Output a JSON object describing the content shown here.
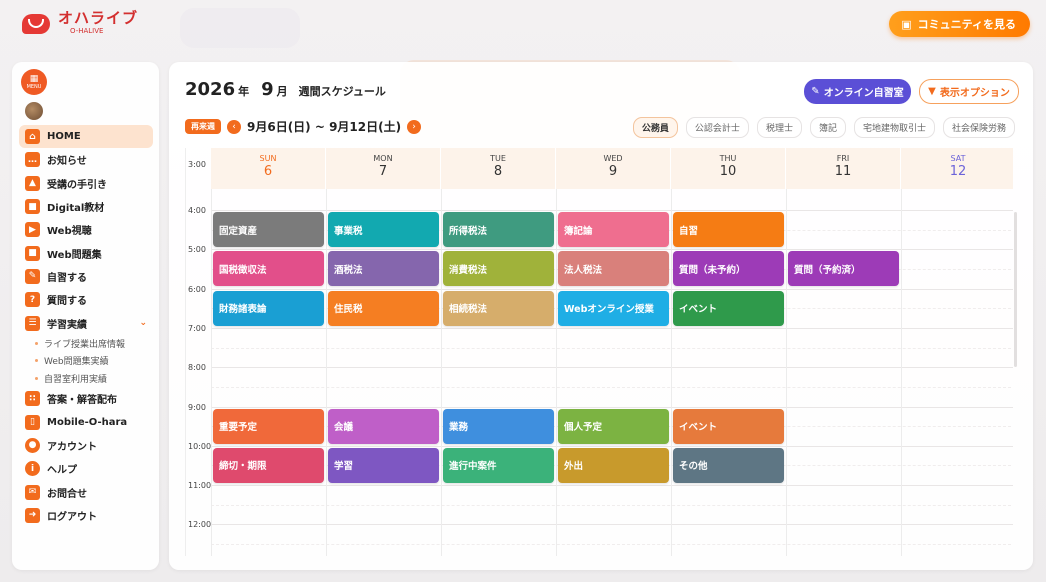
{
  "header": {
    "logo_title": "オハライブ",
    "logo_sub": "O-HALIVE",
    "community_label": "コミュニティを見る"
  },
  "sidebar": {
    "menu_label": "MENU",
    "items": [
      {
        "label": "HOME",
        "icon": "home-icon"
      },
      {
        "label": "お知らせ",
        "icon": "chat-icon"
      },
      {
        "label": "受講の手引き",
        "icon": "graduation-cap-icon"
      },
      {
        "label": "Digital教材",
        "icon": "book-icon"
      },
      {
        "label": "Web視聴",
        "icon": "play-icon"
      },
      {
        "label": "Web問題集",
        "icon": "book-icon"
      },
      {
        "label": "自習する",
        "icon": "pencil-icon"
      },
      {
        "label": "質問する",
        "icon": "question-icon"
      },
      {
        "label": "学習実績",
        "icon": "chart-icon"
      },
      {
        "label": "答案・解答配布",
        "icon": "dots-grid-icon"
      },
      {
        "label": "Mobile-O-hara",
        "icon": "mobile-icon"
      },
      {
        "label": "アカウント",
        "icon": "user-icon"
      },
      {
        "label": "ヘルプ",
        "icon": "info-icon"
      },
      {
        "label": "お問合せ",
        "icon": "mail-icon"
      },
      {
        "label": "ログアウト",
        "icon": "logout-icon"
      }
    ],
    "sub_items": [
      "ライブ授業出席情報",
      "Web問題集実績",
      "自習室利用実績"
    ]
  },
  "main": {
    "year": "2026",
    "year_unit": "年",
    "month": "9",
    "month_unit": "月",
    "schedule_label": "週間スケジュール",
    "online_btn": "オンライン自習室",
    "options_btn": "表示オプション",
    "next_week": "再来週",
    "range": "9月6日(日) ~ 9月12日(土)",
    "filters": [
      "公務員",
      "公認会計士",
      "税理士",
      "簿記",
      "宅地建物取引士",
      "社会保険労務"
    ],
    "days": [
      {
        "name": "SUN",
        "date": "6"
      },
      {
        "name": "MON",
        "date": "7"
      },
      {
        "name": "TUE",
        "date": "8"
      },
      {
        "name": "WED",
        "date": "9"
      },
      {
        "name": "THU",
        "date": "10"
      },
      {
        "name": "FRI",
        "date": "11"
      },
      {
        "name": "SAT",
        "date": "12"
      }
    ],
    "hours": [
      "3:00",
      "4:00",
      "5:00",
      "6:00",
      "7:00",
      "8:00",
      "9:00",
      "10:00",
      "11:00",
      "12:00"
    ],
    "events": [
      {
        "label": "固定資産",
        "day": 0,
        "hour": 4,
        "color": "#7b7b7b"
      },
      {
        "label": "事業税",
        "day": 1,
        "hour": 4,
        "color": "#12a9b0"
      },
      {
        "label": "所得税法",
        "day": 2,
        "hour": 4,
        "color": "#3f9b80"
      },
      {
        "label": "簿記論",
        "day": 3,
        "hour": 4,
        "color": "#ef6e8f"
      },
      {
        "label": "自習",
        "day": 4,
        "hour": 4,
        "color": "#f57c14"
      },
      {
        "label": "国税徴収法",
        "day": 0,
        "hour": 5,
        "color": "#e24f8a"
      },
      {
        "label": "酒税法",
        "day": 1,
        "hour": 5,
        "color": "#8566ad"
      },
      {
        "label": "消費税法",
        "day": 2,
        "hour": 5,
        "color": "#a0b23a"
      },
      {
        "label": "法人税法",
        "day": 3,
        "hour": 5,
        "color": "#d9807b"
      },
      {
        "label": "質問（未予約）",
        "day": 4,
        "hour": 5,
        "color": "#9d3bb7"
      },
      {
        "label": "質問（予約済）",
        "day": 5,
        "hour": 5,
        "color": "#9d3bb7"
      },
      {
        "label": "財務諸表論",
        "day": 0,
        "hour": 6,
        "color": "#1a9fd3"
      },
      {
        "label": "住民税",
        "day": 1,
        "hour": 6,
        "color": "#f57e22"
      },
      {
        "label": "相続税法",
        "day": 2,
        "hour": 6,
        "color": "#d6ad6b"
      },
      {
        "label": "Webオンライン授業",
        "day": 3,
        "hour": 6,
        "color": "#1faee5"
      },
      {
        "label": "イベント",
        "day": 4,
        "hour": 6,
        "color": "#2f9a4b"
      },
      {
        "label": "重要予定",
        "day": 0,
        "hour": 9,
        "color": "#f0693a"
      },
      {
        "label": "会議",
        "day": 1,
        "hour": 9,
        "color": "#bf5fc8"
      },
      {
        "label": "業務",
        "day": 2,
        "hour": 9,
        "color": "#3f8fde"
      },
      {
        "label": "個人予定",
        "day": 3,
        "hour": 9,
        "color": "#7cb342"
      },
      {
        "label": "イベント",
        "day": 4,
        "hour": 9,
        "color": "#e67a3c"
      },
      {
        "label": "締切・期限",
        "day": 0,
        "hour": 10,
        "color": "#df4a6d"
      },
      {
        "label": "学習",
        "day": 1,
        "hour": 10,
        "color": "#7e57c2"
      },
      {
        "label": "進行中案件",
        "day": 2,
        "hour": 10,
        "color": "#3bb27a"
      },
      {
        "label": "外出",
        "day": 3,
        "hour": 10,
        "color": "#c89a2c"
      },
      {
        "label": "その他",
        "day": 4,
        "hour": 10,
        "color": "#5e7684"
      }
    ]
  }
}
